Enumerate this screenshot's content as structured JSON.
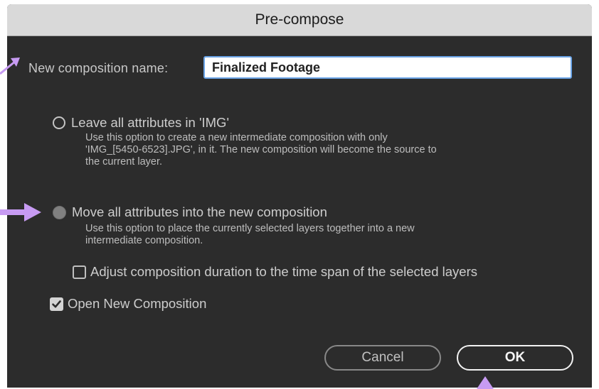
{
  "dialog": {
    "title": "Pre-compose"
  },
  "name_field": {
    "label": "New composition name:",
    "value": "Finalized Footage"
  },
  "options": {
    "leave": {
      "label": "Leave all attributes in 'IMG'",
      "desc1": "Use this option to create a new intermediate composition with only",
      "desc2": "'IMG_[5450-6523].JPG', in it. The new composition will become the source to",
      "desc3": "the current layer.",
      "selected": false
    },
    "move": {
      "label": "Move all attributes into the new composition",
      "desc1": "Use this option to place the currently selected layers together into a new",
      "desc2": "intermediate composition.",
      "selected": true
    }
  },
  "checkboxes": {
    "adjust_duration": {
      "label": "Adjust composition duration to the time span of the selected layers",
      "checked": false
    },
    "open_new": {
      "label": "Open New Composition",
      "checked": true
    }
  },
  "buttons": {
    "cancel": "Cancel",
    "ok": "OK"
  },
  "colors": {
    "dialog_bg": "#2c2c2c",
    "titlebar_bg": "#d9d9d9",
    "input_border": "#6aa3e6",
    "annotation_arrow": "#c79bf2"
  }
}
